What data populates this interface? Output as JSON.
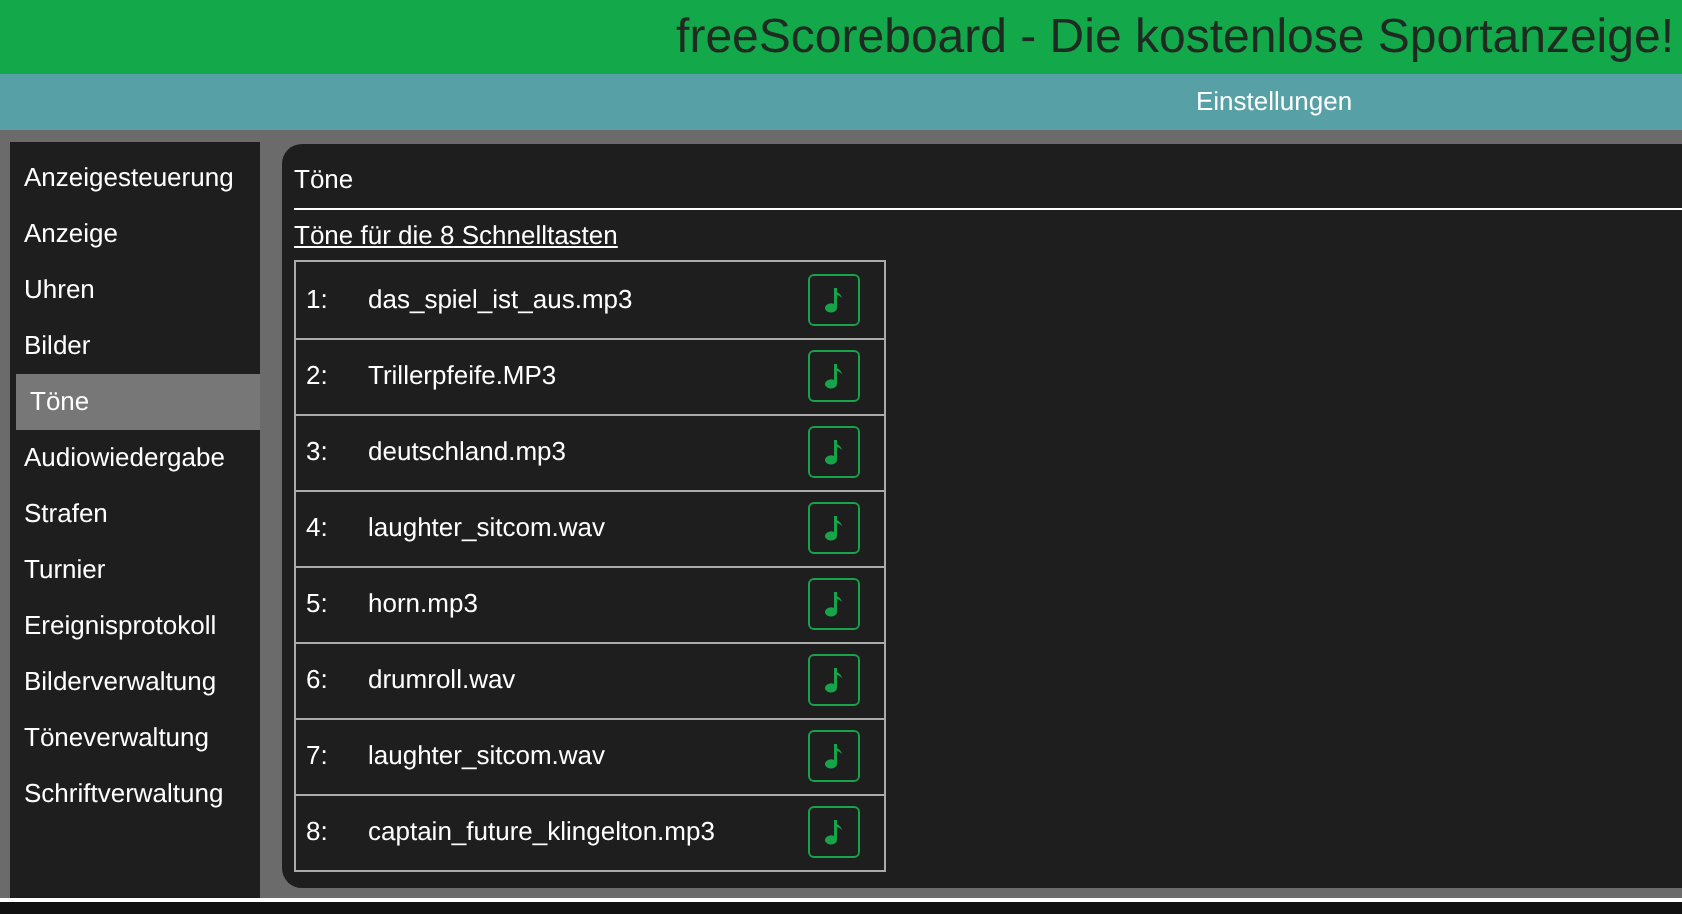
{
  "header": {
    "title": "freeScoreboard - Die kostenlose Sportanzeige!"
  },
  "subheader": {
    "title": "Einstellungen"
  },
  "sidebar": {
    "items": [
      {
        "label": "Anzeigesteuerung",
        "selected": false
      },
      {
        "label": "Anzeige",
        "selected": false
      },
      {
        "label": "Uhren",
        "selected": false
      },
      {
        "label": "Bilder",
        "selected": false
      },
      {
        "label": "Töne",
        "selected": true
      },
      {
        "label": "Audiowiedergabe",
        "selected": false
      },
      {
        "label": "Strafen",
        "selected": false
      },
      {
        "label": "Turnier",
        "selected": false
      },
      {
        "label": "Ereignisprotokoll",
        "selected": false
      },
      {
        "label": "Bilderverwaltung",
        "selected": false
      },
      {
        "label": "Töneverwaltung",
        "selected": false
      },
      {
        "label": "Schriftverwaltung",
        "selected": false
      }
    ]
  },
  "panel": {
    "title": "Töne",
    "section_title": "Töne für die 8 Schnelltasten",
    "rows": [
      {
        "number": "1:",
        "file": "das_spiel_ist_aus.mp3"
      },
      {
        "number": "2:",
        "file": "Trillerpfeife.MP3"
      },
      {
        "number": "3:",
        "file": "deutschland.mp3"
      },
      {
        "number": "4:",
        "file": "laughter_sitcom.wav"
      },
      {
        "number": "5:",
        "file": "horn.mp3"
      },
      {
        "number": "6:",
        "file": "drumroll.wav"
      },
      {
        "number": "7:",
        "file": "laughter_sitcom.wav"
      },
      {
        "number": "8:",
        "file": "captain_future_klingelton.mp3"
      }
    ]
  }
}
